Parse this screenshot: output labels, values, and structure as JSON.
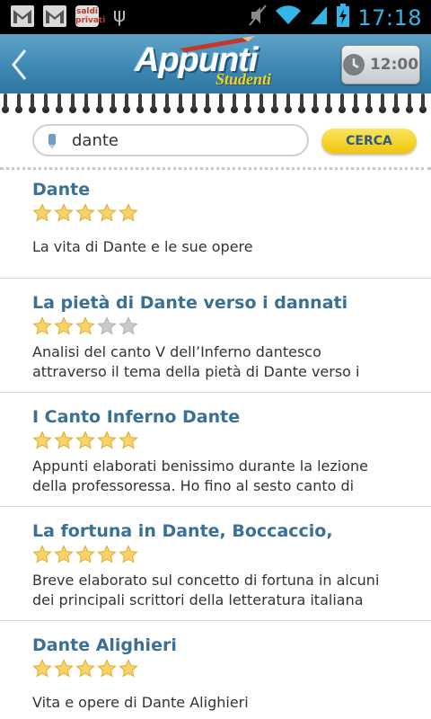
{
  "status_bar": {
    "time": "17:18",
    "notification_icons": [
      "gmail-icon",
      "gmail-icon",
      "saldi-privati-icon",
      "usb-icon"
    ],
    "saldi_label": "saldi privati",
    "system_icons": [
      "mute-icon",
      "wifi-icon",
      "signal-icon",
      "battery-charging-icon"
    ]
  },
  "header": {
    "logo_main": "Appunti",
    "logo_sub": "Studenti",
    "timer_label": "12:00"
  },
  "search": {
    "query": "dante",
    "button_label": "CERCA"
  },
  "results": [
    {
      "title": "Dante",
      "rating": 5,
      "description": "La vita di Dante e le sue opere"
    },
    {
      "title": "La pietà di Dante verso i dannati",
      "rating": 3,
      "description": "Analisi del canto V dell’Inferno dantesco attraverso il tema della pietà di Dante verso i"
    },
    {
      "title": "I Canto Inferno Dante",
      "rating": 5,
      "description": "Appunti elaborati benissimo durante la lezione della professoressa. Ho fino al sesto canto di"
    },
    {
      "title": "La fortuna in Dante, Boccaccio,",
      "rating": 5,
      "description": "Breve elaborato sul concetto di fortuna in alcuni dei principali scrittori della letteratura italiana"
    },
    {
      "title": "Dante Alighieri",
      "rating": 5,
      "description": "Vita e opere di Dante Alighieri"
    }
  ],
  "colors": {
    "header_blue": "#3b86b2",
    "title_blue": "#3a6f96",
    "button_yellow": "#f1c40f",
    "status_blue": "#33b5e5"
  }
}
